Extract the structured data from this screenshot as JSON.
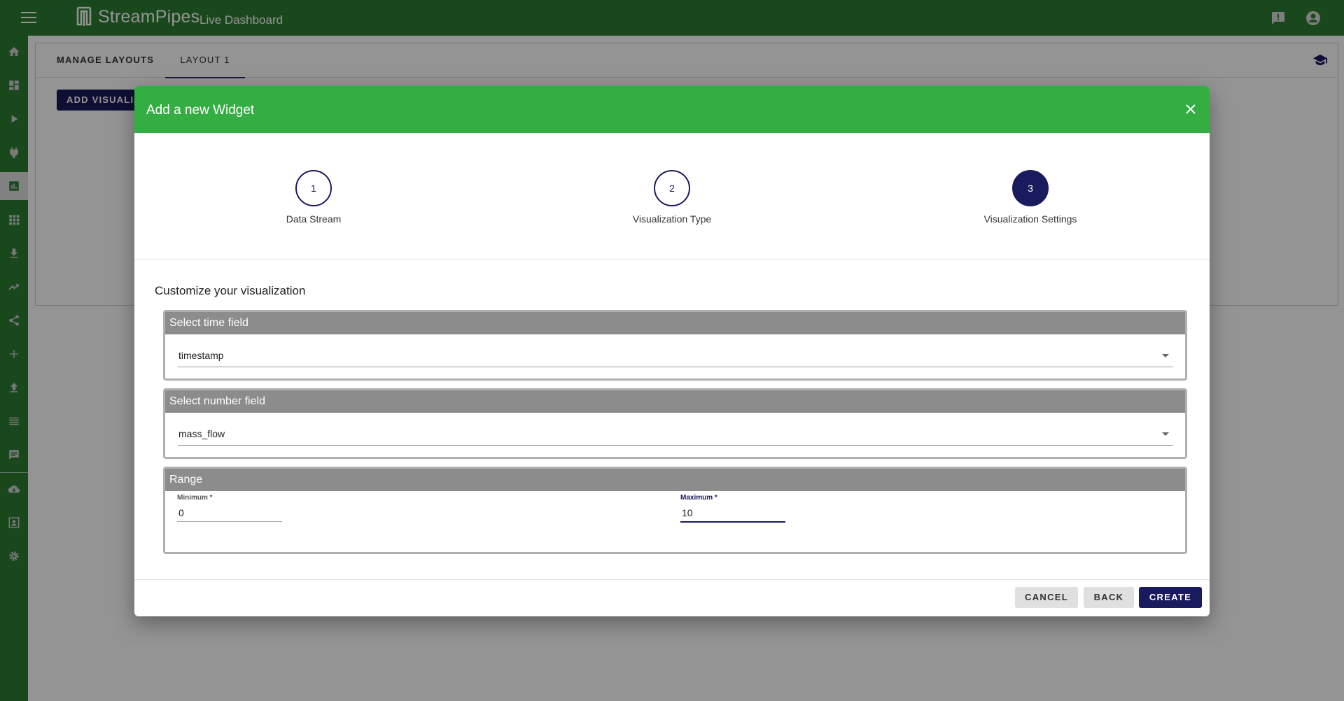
{
  "header": {
    "logo_text": "StreamPipes",
    "app_title": "Live Dashboard",
    "icons": [
      "menu-icon",
      "feedback-icon",
      "account-icon"
    ]
  },
  "sidebar": {
    "items": [
      {
        "icon": "home-icon"
      },
      {
        "icon": "dashboard-icon"
      },
      {
        "icon": "play-icon"
      },
      {
        "icon": "plug-icon"
      },
      {
        "icon": "bar-chart-icon",
        "active": true
      },
      {
        "icon": "apps-icon"
      },
      {
        "icon": "download-icon"
      },
      {
        "icon": "trending-up-icon"
      },
      {
        "icon": "share-icon"
      },
      {
        "icon": "add-icon"
      },
      {
        "icon": "upload-icon"
      },
      {
        "icon": "list-icon"
      },
      {
        "icon": "chat-icon"
      },
      {
        "icon": "cloud-download-icon"
      },
      {
        "icon": "contact-icon"
      },
      {
        "icon": "settings-icon"
      }
    ]
  },
  "background": {
    "tabs": [
      {
        "label": "MANAGE LAYOUTS"
      },
      {
        "label": "LAYOUT 1"
      }
    ],
    "add_button": "ADD VISUALIZATION"
  },
  "dialog": {
    "title": "Add a new Widget",
    "steps": [
      {
        "number": "1",
        "label": "Data Stream"
      },
      {
        "number": "2",
        "label": "Visualization Type"
      },
      {
        "number": "3",
        "label": "Visualization Settings"
      }
    ],
    "customize_heading": "Customize your visualization",
    "time_field": {
      "title": "Select time field",
      "value": "timestamp"
    },
    "number_field": {
      "title": "Select number field",
      "value": "mass_flow"
    },
    "range": {
      "title": "Range",
      "min_label": "Minimum *",
      "min_value": "0",
      "max_label": "Maximum *",
      "max_value": "10"
    },
    "buttons": {
      "cancel": "CANCEL",
      "back": "BACK",
      "create": "CREATE"
    }
  },
  "colors": {
    "topbar": "#2e7d32",
    "dialog_header": "#34ad42",
    "primary": "#1a1a5e",
    "panel_header": "#8c8c8c"
  }
}
